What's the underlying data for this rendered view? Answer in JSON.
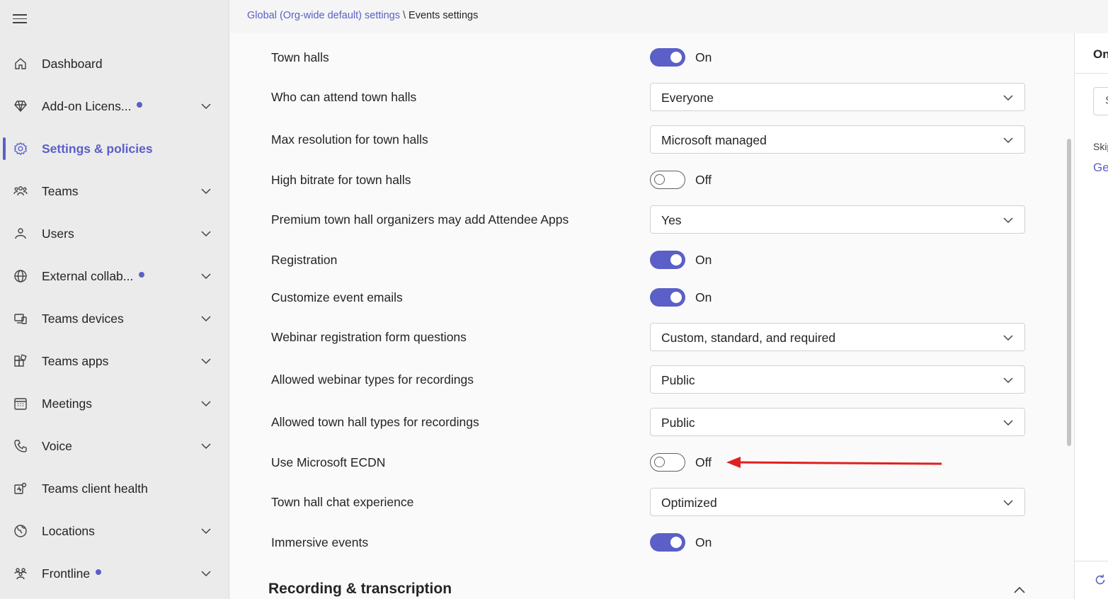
{
  "sidebar": {
    "items": [
      {
        "label": "Dashboard",
        "icon": "home-icon",
        "expandable": false,
        "dot": false,
        "active": false
      },
      {
        "label": "Add-on Licens...",
        "icon": "diamond-icon",
        "expandable": true,
        "dot": true,
        "active": false
      },
      {
        "label": "Settings & policies",
        "icon": "gear-icon",
        "expandable": false,
        "dot": false,
        "active": true
      },
      {
        "label": "Teams",
        "icon": "people-team-icon",
        "expandable": true,
        "dot": false,
        "active": false
      },
      {
        "label": "Users",
        "icon": "person-icon",
        "expandable": true,
        "dot": false,
        "active": false
      },
      {
        "label": "External collab...",
        "icon": "globe-icon",
        "expandable": true,
        "dot": true,
        "active": false
      },
      {
        "label": "Teams devices",
        "icon": "devices-icon",
        "expandable": true,
        "dot": false,
        "active": false
      },
      {
        "label": "Teams apps",
        "icon": "apps-icon",
        "expandable": true,
        "dot": false,
        "active": false
      },
      {
        "label": "Meetings",
        "icon": "calendar-icon",
        "expandable": true,
        "dot": false,
        "active": false
      },
      {
        "label": "Voice",
        "icon": "phone-icon",
        "expandable": true,
        "dot": false,
        "active": false
      },
      {
        "label": "Teams client health",
        "icon": "client-health-icon",
        "expandable": false,
        "dot": false,
        "active": false
      },
      {
        "label": "Locations",
        "icon": "globe-location-icon",
        "expandable": true,
        "dot": false,
        "active": false
      },
      {
        "label": "Frontline",
        "icon": "frontline-people-icon",
        "expandable": true,
        "dot": true,
        "active": false
      }
    ]
  },
  "breadcrumb": {
    "parent": "Global (Org-wide default) settings",
    "separator": "\\",
    "current": "Events settings"
  },
  "settings": [
    {
      "label": "Town halls",
      "type": "toggle",
      "on": true,
      "state_text": "On"
    },
    {
      "label": "Who can attend town halls",
      "type": "select",
      "value": "Everyone"
    },
    {
      "label": "Max resolution for town halls",
      "type": "select",
      "value": "Microsoft managed"
    },
    {
      "label": "High bitrate for town halls",
      "type": "toggle",
      "on": false,
      "state_text": "Off"
    },
    {
      "label": "Premium town hall organizers may add Attendee Apps",
      "type": "select",
      "value": "Yes"
    },
    {
      "label": "Registration",
      "type": "toggle",
      "on": true,
      "state_text": "On"
    },
    {
      "label": "Customize event emails",
      "type": "toggle",
      "on": true,
      "state_text": "On"
    },
    {
      "label": "Webinar registration form questions",
      "type": "select",
      "value": "Custom, standard, and required"
    },
    {
      "label": "Allowed webinar types for recordings",
      "type": "select",
      "value": "Public"
    },
    {
      "label": "Allowed town hall types for recordings",
      "type": "select",
      "value": "Public"
    },
    {
      "label": "Use Microsoft ECDN",
      "type": "toggle",
      "on": false,
      "state_text": "Off"
    },
    {
      "label": "Town hall chat experience",
      "type": "select",
      "value": "Optimized"
    },
    {
      "label": "Immersive events",
      "type": "toggle",
      "on": true,
      "state_text": "On"
    }
  ],
  "section": {
    "title": "Recording & transcription"
  },
  "right_panel": {
    "heading": "On",
    "input_text": "S",
    "skip_text": "Skip",
    "link_text": "Ge"
  },
  "colors": {
    "accent": "#5b5fc7",
    "annotation_arrow": "#e02020"
  }
}
